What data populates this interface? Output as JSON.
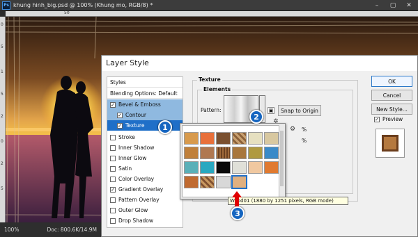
{
  "window": {
    "title": "khung hinh_big.psd @ 100% (Khung mo, RGB/8) *",
    "logo": "Ps"
  },
  "ruler": {
    "top_label": "50",
    "left_ticks": [
      "0",
      "5",
      "1",
      "5",
      "2",
      "0",
      "2",
      "5"
    ]
  },
  "status": {
    "zoom": "100%",
    "doc": "Doc: 800.6K/14.9M"
  },
  "dialog": {
    "title": "Layer Style",
    "styles_header": "Styles",
    "blending": "Blending Options: Default",
    "items": [
      {
        "label": "Bevel & Emboss",
        "checked": true
      },
      {
        "label": "Contour",
        "checked": true,
        "sub": true
      },
      {
        "label": "Texture",
        "checked": true,
        "sub": true
      },
      {
        "label": "Stroke",
        "checked": false
      },
      {
        "label": "Inner Shadow",
        "checked": false
      },
      {
        "label": "Inner Glow",
        "checked": false
      },
      {
        "label": "Satin",
        "checked": false
      },
      {
        "label": "Color Overlay",
        "checked": false
      },
      {
        "label": "Gradient Overlay",
        "checked": true
      },
      {
        "label": "Pattern Overlay",
        "checked": false
      },
      {
        "label": "Outer Glow",
        "checked": false
      },
      {
        "label": "Drop Shadow",
        "checked": false
      }
    ],
    "texture": {
      "group": "Texture",
      "elements": "Elements",
      "pattern_label": "Pattern:",
      "snap": "Snap to Origin",
      "pct1": "%",
      "pct2": "%"
    },
    "buttons": {
      "ok": "OK",
      "cancel": "Cancel",
      "new_style": "New Style...",
      "preview": "Preview"
    }
  },
  "tooltip": "Wood01 (1880 by 1251 pixels, RGB mode)",
  "badges": [
    "1",
    "2",
    "3"
  ],
  "colors": {
    "accent": "#1f6fc8",
    "selection": "#8fb9e0",
    "badge": "#1565c0",
    "arrow": "#e00000"
  }
}
